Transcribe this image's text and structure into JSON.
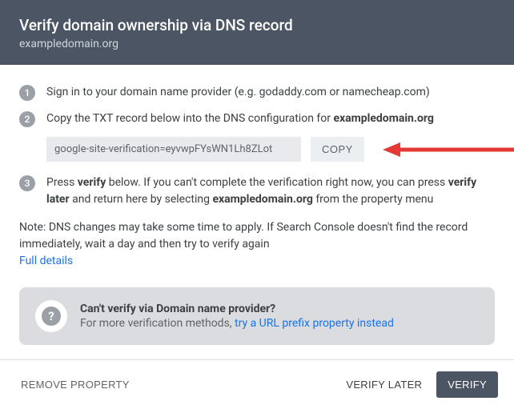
{
  "header": {
    "title": "Verify domain ownership via DNS record",
    "subtitle": "exampledomain.org"
  },
  "steps": {
    "one": {
      "num": "1",
      "text": "Sign in to your domain name provider (e.g. godaddy.com or namecheap.com)"
    },
    "two": {
      "num": "2",
      "prefix": "Copy the TXT record below into the DNS configuration for ",
      "domain": "exampledomain.org",
      "txt_record": "google-site-verification=eyvwpFYsWN1Lh8ZLot",
      "copy_label": "COPY"
    },
    "three": {
      "num": "3",
      "part1": "Press ",
      "bold1": "verify",
      "part2": " below. If you can't complete the verification right now, you can press ",
      "bold2": "verify later",
      "part3": " and return here by selecting ",
      "bold3": "exampledomain.org",
      "part4": " from the property menu"
    }
  },
  "note": {
    "text": "Note: DNS changes may take some time to apply. If Search Console doesn't find the record immediately, wait a day and then try to verify again",
    "link": "Full details"
  },
  "alt": {
    "icon": "?",
    "title": "Can't verify via Domain name provider?",
    "sub_prefix": "For more verification methods, ",
    "sub_link": "try a URL prefix property instead"
  },
  "footer": {
    "remove": "REMOVE PROPERTY",
    "verify_later": "VERIFY LATER",
    "verify": "VERIFY"
  }
}
